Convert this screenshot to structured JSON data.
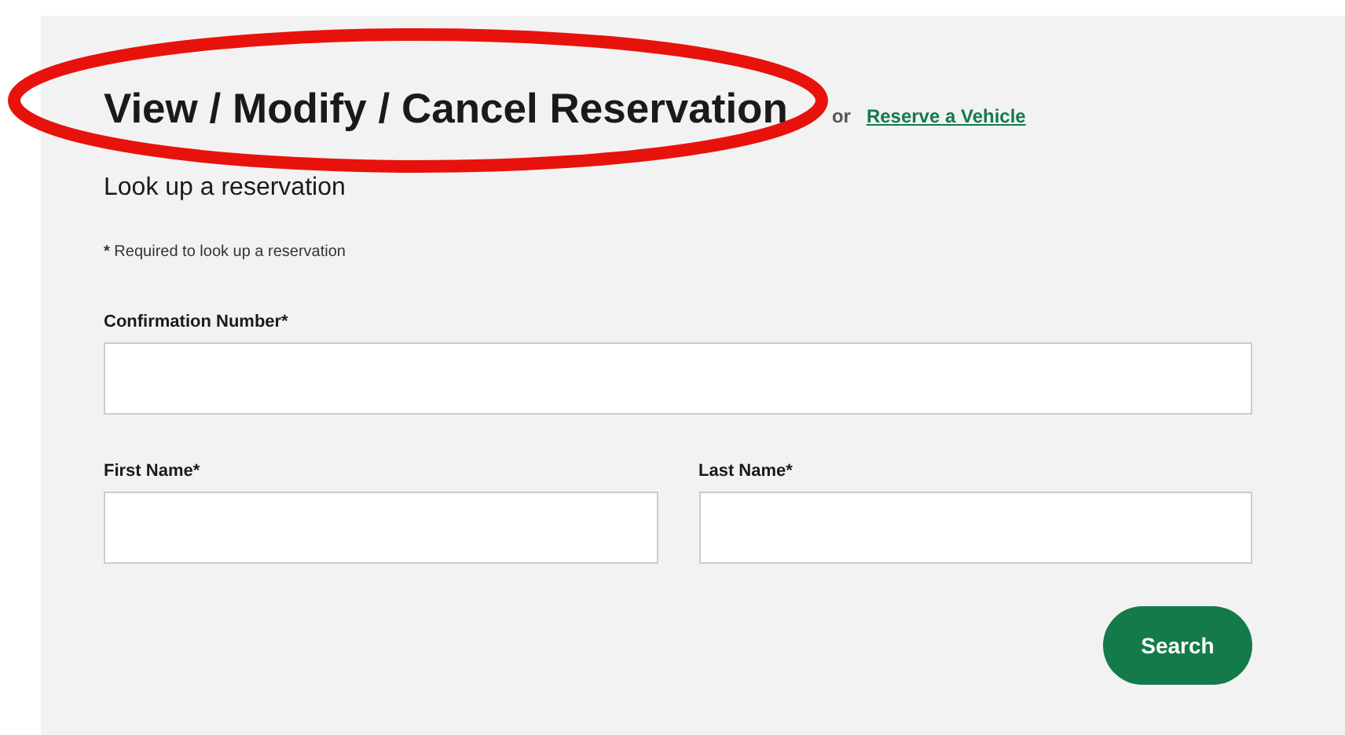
{
  "heading": {
    "title": "View / Modify / Cancel Reservation",
    "or_text": "or",
    "link": "Reserve a Vehicle"
  },
  "subtitle": "Look up a reservation",
  "required_note": {
    "mark": "*",
    "text": "Required to look up a reservation"
  },
  "fields": [
    {
      "label": "Confirmation Number*"
    }
  ],
  "name_fields": [
    {
      "label": "First Name*"
    },
    {
      "label": "Last Name*"
    }
  ],
  "button": "Search"
}
